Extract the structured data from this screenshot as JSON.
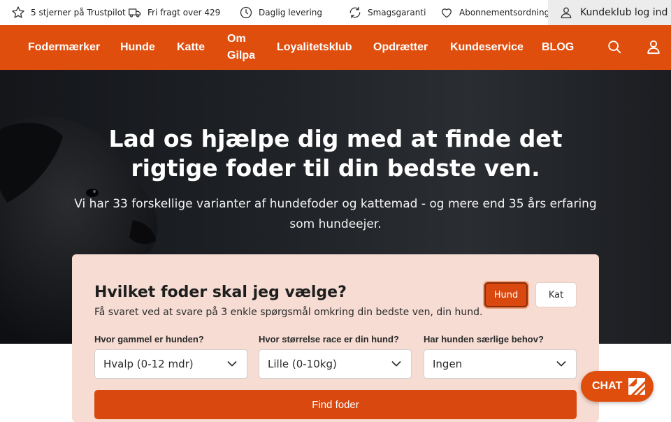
{
  "topbar": {
    "trustpilot": "5 stjerner på Trustpilot",
    "free_shipping": "Fri fragt over 429",
    "daily_delivery": "Daglig levering",
    "taste_guarantee": "Smagsgaranti",
    "subscription": "Abonnementsordning",
    "login": "Kundeklub log ind"
  },
  "nav": {
    "items": [
      "Fodermærker",
      "Hunde",
      "Katte",
      "Om",
      "Gilpa",
      "Loyalitetsklub",
      "Opdrætter",
      "Kundeservice",
      "BLOG"
    ],
    "search_icon": "search-icon",
    "account_icon": "user-icon"
  },
  "hero": {
    "title": "Lad os hjælpe dig med at finde det rigtige foder til din bedste ven.",
    "subtitle": "Vi har 33 forskellige varianter af hundefoder og kattemad - og mere end 35 års erfaring som hundeejer."
  },
  "finder": {
    "title": "Hvilket foder skal jeg vælge?",
    "subtitle": "Få svaret ved at svare på 3 enkle spørgsmål omkring din bedste ven, din hund.",
    "toggle_dog": "Hund",
    "toggle_cat": "Kat",
    "selected_toggle": "Hund",
    "age_label": "Hvor gammel er hunden?",
    "age_value": "Hvalp (0-12 mdr)",
    "size_label": "Hvor størrelse race er din hund?",
    "size_value": "Lille (0-10kg)",
    "needs_label": "Har hunden særlige behov?",
    "needs_value": "Ingen",
    "submit_label": "Find foder"
  },
  "chat": {
    "label": "CHAT"
  },
  "colors": {
    "brand_orange": "#e04e0e",
    "button_orange": "#d9480f",
    "card_bg": "#f6dcd2",
    "hero_bg": "#1d2024"
  }
}
